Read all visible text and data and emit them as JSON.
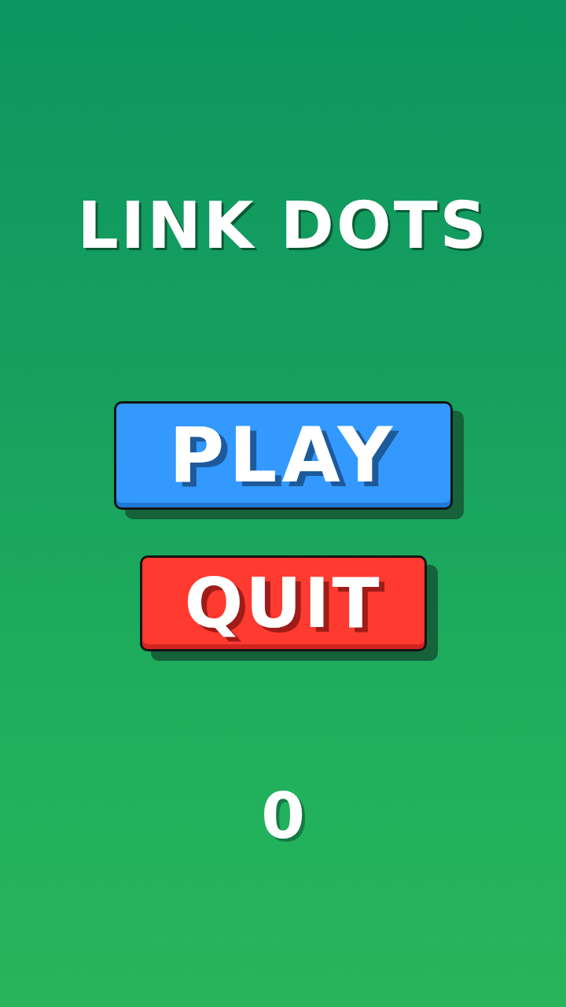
{
  "title": "LINK DOTS",
  "buttons": [
    {
      "label": "PLAY",
      "kind": "play"
    },
    {
      "label": "QUIT",
      "kind": "quit"
    }
  ],
  "score": "0"
}
